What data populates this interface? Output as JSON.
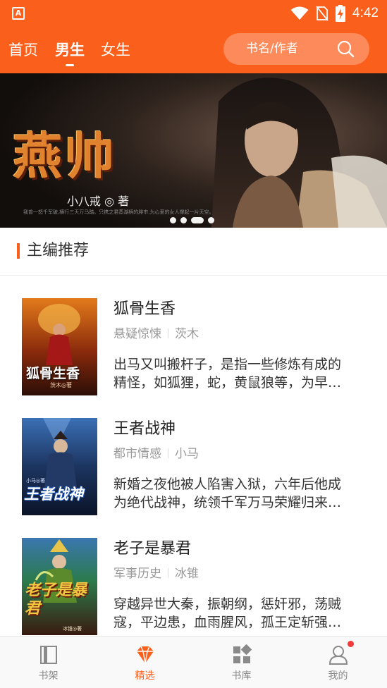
{
  "status_bar": {
    "app_icon_letter": "A",
    "time": "4:42"
  },
  "header": {
    "tabs": [
      {
        "label": "首页",
        "active": false
      },
      {
        "label": "男生",
        "active": true
      },
      {
        "label": "女生",
        "active": false
      }
    ],
    "search": {
      "placeholder": "书名/作者"
    }
  },
  "banner": {
    "title": "燕帅",
    "author": "小八戒 ◎ 著",
    "caption": "我曾一怒千军破,横行三天万马踏。只携之君蒸湖柄的腓市,为心爱的女人撑起一片天空。",
    "slide_count": 4,
    "active_slide": 3
  },
  "section": {
    "title": "主编推荐"
  },
  "books": [
    {
      "title": "狐骨生香",
      "category": "悬疑惊悚",
      "author": "茨木",
      "desc_line1": "出马又叫搬杆子，是指一些修炼有成的",
      "desc_line2": "精怪，如狐狸，蛇，黄鼠狼等，为早…",
      "cover_title": "狐骨生香",
      "cover_author": "茨木◎著"
    },
    {
      "title": "王者战神",
      "category": "都市情感",
      "author": "小马",
      "desc_line1": "新婚之夜他被人陷害入狱，六年后他成",
      "desc_line2": "为绝代战神，统领千军万马荣耀归来…",
      "cover_title": "王者战神",
      "cover_author": "小马◎著"
    },
    {
      "title": "老子是暴君",
      "category": "军事历史",
      "author": "冰锥",
      "desc_line1": "穿越异世大秦，振朝纲，惩奸邪，荡贼",
      "desc_line2": "寇，平边患，血雨腥风，孤王定斩强…",
      "cover_title": "老子是暴君",
      "cover_author": "冰锥◎著"
    }
  ],
  "bottom_nav": [
    {
      "label": "书架",
      "icon": "bookshelf-icon",
      "active": false
    },
    {
      "label": "精选",
      "icon": "diamond-icon",
      "active": true
    },
    {
      "label": "书库",
      "icon": "library-grid-icon",
      "active": false
    },
    {
      "label": "我的",
      "icon": "user-icon",
      "active": false,
      "badge": true
    }
  ],
  "colors": {
    "brand": "#fb5f1c",
    "badge": "#f23a3a"
  }
}
